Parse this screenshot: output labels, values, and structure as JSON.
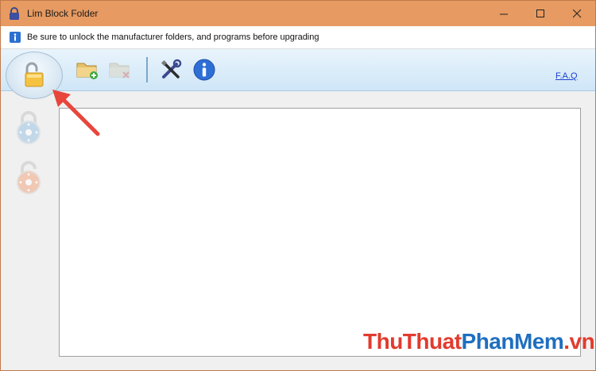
{
  "window": {
    "title": "Lim Block Folder",
    "controls": [
      "minimize",
      "maximize",
      "close"
    ]
  },
  "infobar": {
    "icon": "info-icon",
    "text": "Be sure to unlock the manufacturer folders, and programs before upgrading"
  },
  "toolbar": {
    "buttons": [
      {
        "name": "lock-toggle",
        "icon": "open-padlock-icon"
      },
      {
        "name": "add-folder",
        "icon": "folder-add-icon"
      },
      {
        "name": "remove-folder",
        "icon": "folder-remove-icon",
        "disabled": true
      },
      {
        "name": "settings",
        "icon": "tools-icon"
      },
      {
        "name": "about",
        "icon": "info-icon"
      }
    ],
    "faq_label": "F.A.Q"
  },
  "sidebar": {
    "buttons": [
      {
        "name": "lock",
        "icon": "blue-lock-icon",
        "disabled": true
      },
      {
        "name": "unlock",
        "icon": "orange-lock-icon",
        "disabled": true
      }
    ]
  },
  "watermark": {
    "part1": "ThuThuat",
    "part2": "PhanMem",
    "part3": ".vn"
  },
  "colors": {
    "titlebar": "#e79a61",
    "toolbar": "#d6eaf8",
    "accent_arrow": "#e8453c",
    "faq_link": "#1a3fcf"
  }
}
